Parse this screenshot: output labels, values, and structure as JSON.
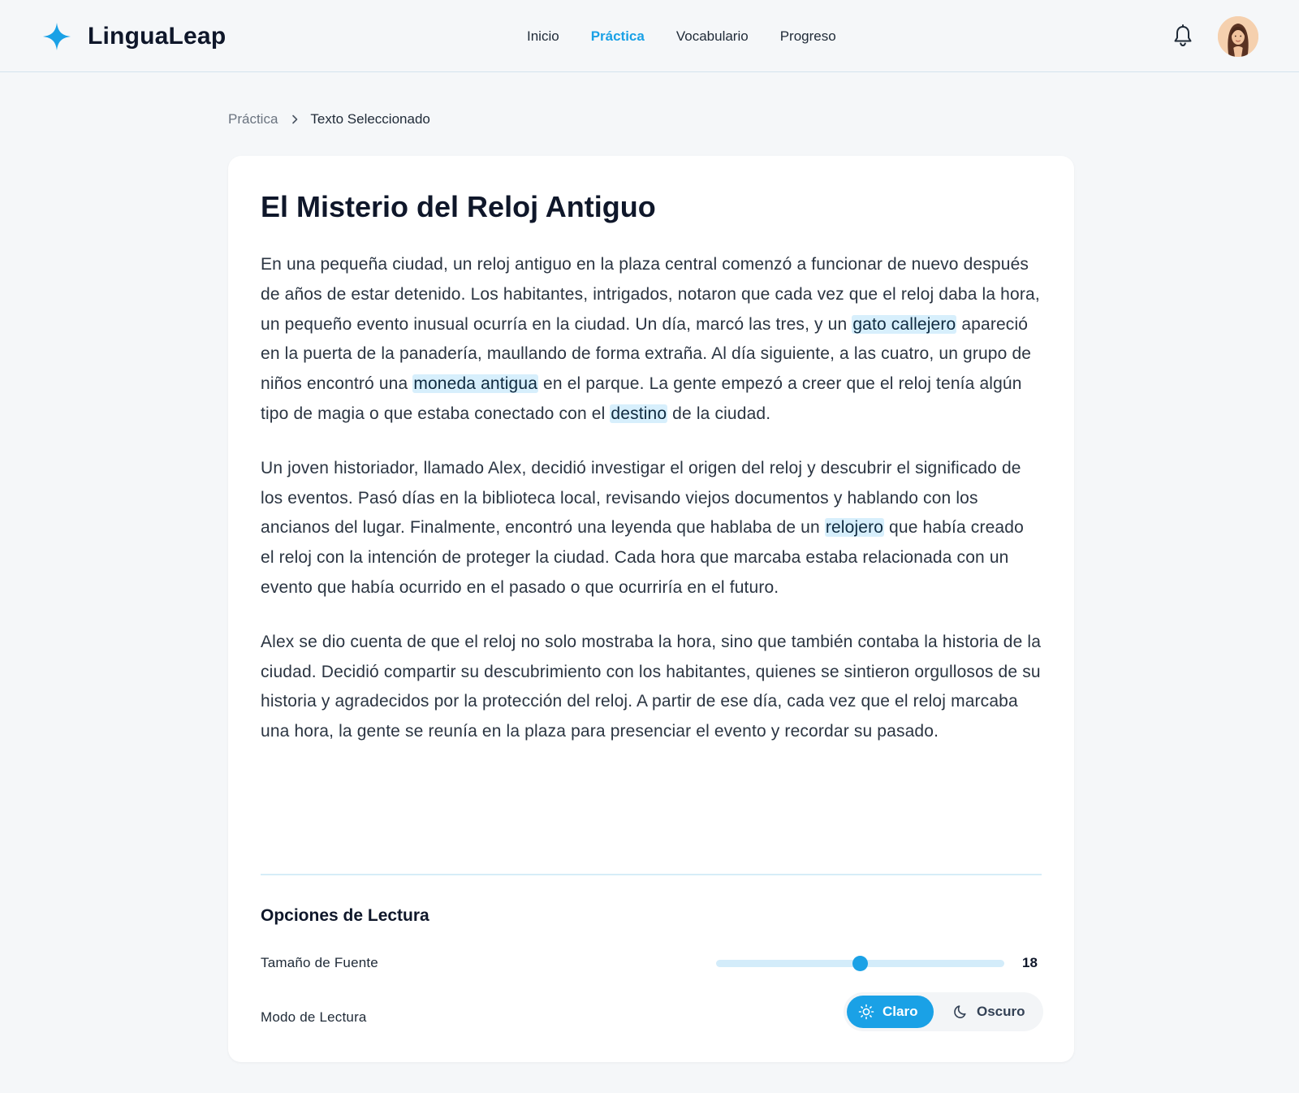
{
  "app": {
    "name": "LinguaLeap",
    "brand_color": "#1aa1e6",
    "logo_icon": "four-point-star-icon"
  },
  "nav": {
    "items": [
      {
        "label": "Inicio",
        "active": false
      },
      {
        "label": "Práctica",
        "active": true
      },
      {
        "label": "Vocabulario",
        "active": false
      },
      {
        "label": "Progreso",
        "active": false
      }
    ]
  },
  "header_actions": {
    "notifications_icon": "bell-icon",
    "avatar_icon": "user-avatar"
  },
  "breadcrumb": {
    "parent": "Práctica",
    "separator_icon": "chevron-right-icon",
    "current": "Texto Seleccionado"
  },
  "story": {
    "title": "El Misterio del Reloj Antiguo",
    "highlight_color": "#d7effc",
    "paragraphs": [
      [
        {
          "text": "En una pequeña ciudad, un reloj antiguo en la plaza central comenzó a funcionar de nuevo después de años de estar detenido. Los habitantes, intrigados, notaron que cada vez que el reloj daba la hora, un pequeño evento inusual ocurría en la ciudad. Un día, marcó las tres, y un "
        },
        {
          "text": "gato callejero",
          "highlight": true
        },
        {
          "text": " apareció en la puerta de la panadería, maullando de forma extraña. Al día siguiente, a las cuatro, un grupo de niños encontró una "
        },
        {
          "text": "moneda antigua",
          "highlight": true
        },
        {
          "text": " en el parque. La gente empezó a creer que el reloj tenía algún tipo de magia o que estaba conectado con el "
        },
        {
          "text": "destino",
          "highlight": true
        },
        {
          "text": " de la ciudad."
        }
      ],
      [
        {
          "text": "Un joven historiador, llamado Alex, decidió investigar el origen del reloj y descubrir el significado de los eventos. Pasó días en la biblioteca local, revisando viejos documentos y hablando con los ancianos del lugar. Finalmente, encontró una leyenda que hablaba de un "
        },
        {
          "text": "relojero",
          "highlight": true
        },
        {
          "text": " que había creado el reloj con la intención de proteger la ciudad. Cada hora que marcaba estaba relacionada con un evento que había ocurrido en el pasado o que ocurriría en el futuro."
        }
      ],
      [
        {
          "text": "Alex se dio cuenta de que el reloj no solo mostraba la hora, sino que también contaba la historia de la ciudad. Decidió compartir su descubrimiento con los habitantes, quienes se sintieron orgullosos de su historia y agradecidos por la protección del reloj. A partir de ese día, cada vez que el reloj marcaba una hora, la gente se reunía en la plaza para presenciar el evento y recordar su pasado."
        }
      ]
    ]
  },
  "reading_options": {
    "title": "Opciones de Lectura",
    "font_size": {
      "label": "Tamaño de Fuente",
      "value": "18",
      "slider_fraction": 0.5
    },
    "mode": {
      "label": "Modo de Lectura",
      "options": [
        {
          "label": "Claro",
          "icon": "sun-icon",
          "selected": true
        },
        {
          "label": "Oscuro",
          "icon": "moon-icon",
          "selected": false
        }
      ]
    }
  }
}
